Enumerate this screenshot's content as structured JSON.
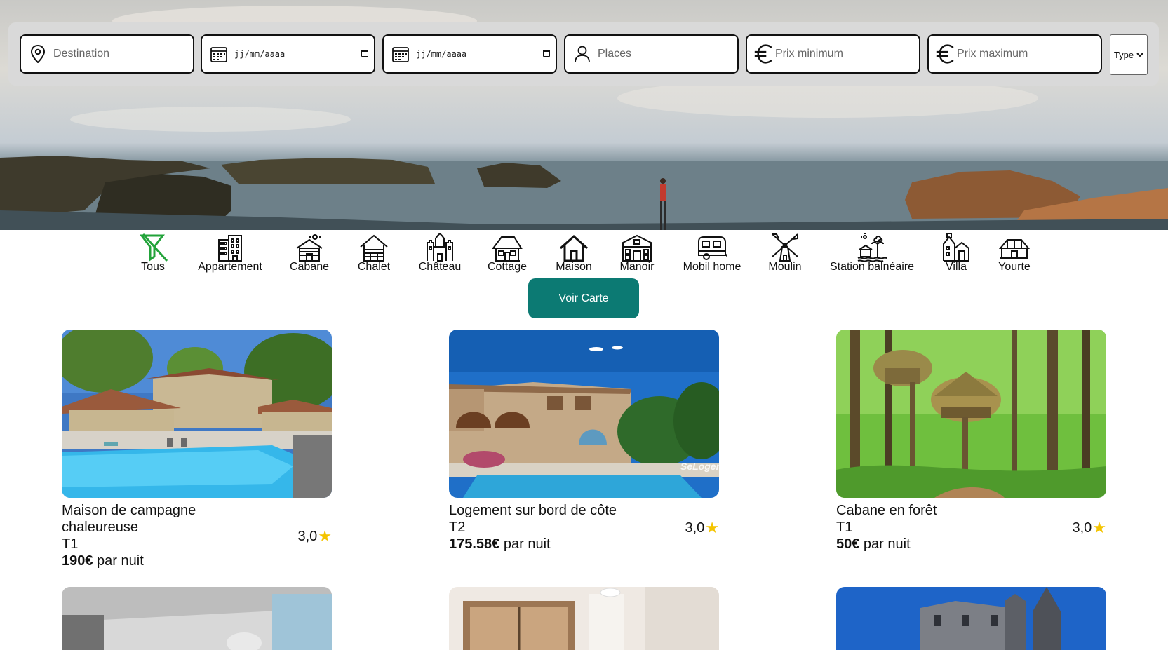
{
  "search": {
    "destination_placeholder": "Destination",
    "date_start_placeholder": "jj/mm/aaaa",
    "date_end_placeholder": "jj/mm/aaaa",
    "places_placeholder": "Places",
    "price_min_placeholder": "Prix minimum",
    "price_max_placeholder": "Prix maximum",
    "type_select": "Type"
  },
  "categories": [
    {
      "label": "Tous",
      "icon": "filter-off-icon",
      "active": true
    },
    {
      "label": "Appartement",
      "icon": "apartment-building-icon"
    },
    {
      "label": "Cabane",
      "icon": "cabin-icon"
    },
    {
      "label": "Chalet",
      "icon": "chalet-icon"
    },
    {
      "label": "Château",
      "icon": "castle-icon"
    },
    {
      "label": "Cottage",
      "icon": "cottage-icon"
    },
    {
      "label": "Maison",
      "icon": "house-icon"
    },
    {
      "label": "Manoir",
      "icon": "manor-icon"
    },
    {
      "label": "Mobil home",
      "icon": "mobile-home-icon"
    },
    {
      "label": "Moulin",
      "icon": "windmill-icon"
    },
    {
      "label": "Station balnéaire",
      "icon": "seaside-resort-icon"
    },
    {
      "label": "Villa",
      "icon": "villa-icon"
    },
    {
      "label": "Yourte",
      "icon": "yurt-icon"
    }
  ],
  "map_button": "Voir Carte",
  "listings": [
    {
      "title": "Maison de campagne chaleureuse",
      "type": "T1",
      "price": "190€",
      "price_suffix": " par nuit",
      "rating": "3,0"
    },
    {
      "title": "Logement sur bord de côte",
      "type": "T2",
      "price": "175.58€",
      "price_suffix": " par nuit",
      "rating": "3,0",
      "watermark": "SeLoger"
    },
    {
      "title": "Cabane en forêt",
      "type": "T1",
      "price": "50€",
      "price_suffix": " par nuit",
      "rating": "3,0"
    }
  ],
  "colors": {
    "accent": "#0c7a73",
    "star": "#f4c400",
    "active_icon": "#22a33a"
  }
}
